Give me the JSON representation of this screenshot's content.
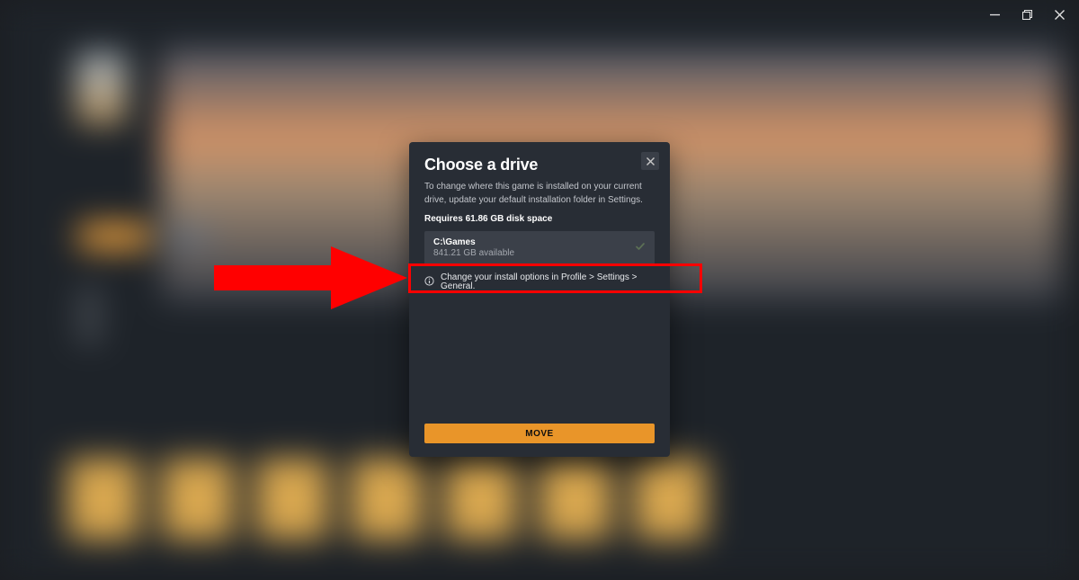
{
  "dialog": {
    "title": "Choose a drive",
    "description": "To change where this game is installed on your current drive, update your default installation folder in Settings.",
    "required_space": "Requires 61.86 GB disk space",
    "drive": {
      "path": "C:\\Games",
      "available": "841.21 GB available"
    },
    "info_hint": "Change your install options in Profile > Settings > General.",
    "move_button": "MOVE"
  },
  "window_controls": {
    "minimize": "minimize",
    "restore": "restore",
    "close": "close"
  }
}
